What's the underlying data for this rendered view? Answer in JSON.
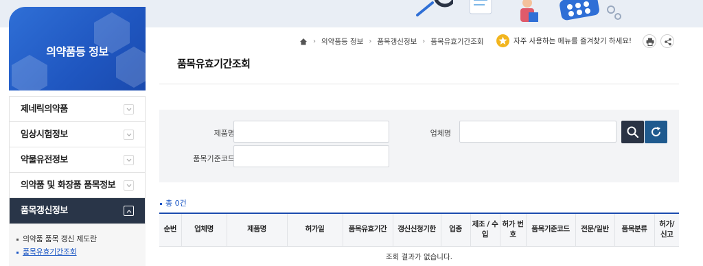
{
  "sidebar": {
    "title": "의약품등 정보",
    "items": [
      {
        "label": "제네릭의약품",
        "active": false
      },
      {
        "label": "임상시험정보",
        "active": false
      },
      {
        "label": "약물유전정보",
        "active": false
      },
      {
        "label": "의약품 및 화장품 품목정보",
        "active": false
      },
      {
        "label": "품목갱신정보",
        "active": true
      }
    ],
    "sub_items": [
      {
        "label": "의약품 품목 갱신 제도란",
        "current": false
      },
      {
        "label": "품목유효기간조회",
        "current": true
      }
    ]
  },
  "breadcrumb": {
    "home_icon": "home-icon",
    "items": [
      "의약품등 정보",
      "품목갱신정보",
      "품목유효기간조회"
    ]
  },
  "favorite": {
    "text": "자주 사용하는 메뉴를 즐겨찾기 하세요!",
    "icon": "star-icon"
  },
  "page": {
    "title": "품목유효기간조회"
  },
  "search": {
    "product_label": "제품명",
    "product_value": "",
    "company_label": "업체명",
    "company_value": "",
    "code_label": "품목기준코드",
    "code_value": "",
    "search_icon": "search-icon",
    "reset_icon": "refresh-icon"
  },
  "result": {
    "total": "총 0건"
  },
  "table": {
    "headers": [
      "순번",
      "업체명",
      "제품명",
      "허가일",
      "품목유효기간",
      "갱신신청기한",
      "업종",
      "제조 / 수입",
      "허가 번호",
      "품목기준코드",
      "전문/일반",
      "품목분류",
      "허가/ 신고"
    ],
    "empty_message": "조회 결과가 없습니다."
  },
  "colors": {
    "accent": "#1a56c4",
    "sidebar_active": "#293548",
    "search_button": "#2a3344",
    "reset_button": "#1f5a8e",
    "favorite": "#f2b51e"
  }
}
